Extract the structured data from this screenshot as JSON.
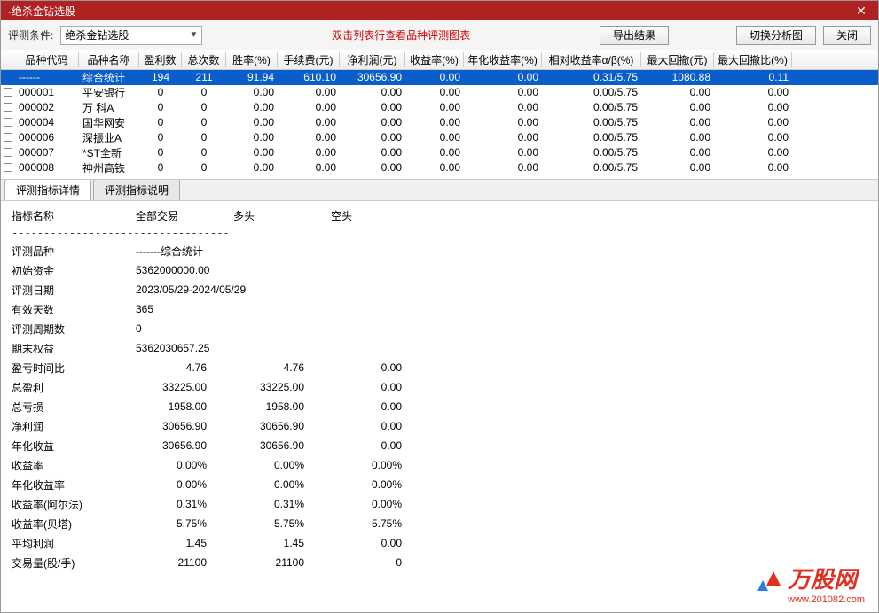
{
  "window": {
    "title": "-绝杀金钻选股"
  },
  "toolbar": {
    "condition_label": "评测条件:",
    "dropdown_value": "绝杀金钻选股",
    "hint": "双击列表行查看品种评测图表",
    "export_label": "导出结果",
    "switch_label": "切换分析图",
    "close_label": "关闭"
  },
  "table": {
    "headers": {
      "code": "品种代码",
      "name": "品种名称",
      "win": "盈利数",
      "total": "总次数",
      "rate": "胜率(%)",
      "fee": "手续费(元)",
      "profit": "净利润(元)",
      "yield": "收益率(%)",
      "ayield": "年化收益率(%)",
      "ab": "相对收益率α/β(%)",
      "maxdd": "最大回撤(元)",
      "maxddr": "最大回撤比(%)"
    },
    "rows": [
      {
        "code": "------",
        "name": "综合统计",
        "win": "194",
        "total": "211",
        "rate": "91.94",
        "fee": "610.10",
        "profit": "30656.90",
        "yield": "0.00",
        "ayield": "0.00",
        "ab": "0.31/5.75",
        "maxdd": "1080.88",
        "maxddr": "0.11",
        "selected": true
      },
      {
        "code": "000001",
        "name": "平安银行",
        "win": "0",
        "total": "0",
        "rate": "0.00",
        "fee": "0.00",
        "profit": "0.00",
        "yield": "0.00",
        "ayield": "0.00",
        "ab": "0.00/5.75",
        "maxdd": "0.00",
        "maxddr": "0.00"
      },
      {
        "code": "000002",
        "name": "万 科A",
        "win": "0",
        "total": "0",
        "rate": "0.00",
        "fee": "0.00",
        "profit": "0.00",
        "yield": "0.00",
        "ayield": "0.00",
        "ab": "0.00/5.75",
        "maxdd": "0.00",
        "maxddr": "0.00"
      },
      {
        "code": "000004",
        "name": "国华网安",
        "win": "0",
        "total": "0",
        "rate": "0.00",
        "fee": "0.00",
        "profit": "0.00",
        "yield": "0.00",
        "ayield": "0.00",
        "ab": "0.00/5.75",
        "maxdd": "0.00",
        "maxddr": "0.00"
      },
      {
        "code": "000006",
        "name": "深振业A",
        "win": "0",
        "total": "0",
        "rate": "0.00",
        "fee": "0.00",
        "profit": "0.00",
        "yield": "0.00",
        "ayield": "0.00",
        "ab": "0.00/5.75",
        "maxdd": "0.00",
        "maxddr": "0.00"
      },
      {
        "code": "000007",
        "name": "*ST全新",
        "win": "0",
        "total": "0",
        "rate": "0.00",
        "fee": "0.00",
        "profit": "0.00",
        "yield": "0.00",
        "ayield": "0.00",
        "ab": "0.00/5.75",
        "maxdd": "0.00",
        "maxddr": "0.00"
      },
      {
        "code": "000008",
        "name": "神州高铁",
        "win": "0",
        "total": "0",
        "rate": "0.00",
        "fee": "0.00",
        "profit": "0.00",
        "yield": "0.00",
        "ayield": "0.00",
        "ab": "0.00/5.75",
        "maxdd": "0.00",
        "maxddr": "0.00"
      }
    ]
  },
  "tabs": {
    "tab1": "评测指标详情",
    "tab2": "评测指标说明"
  },
  "details": {
    "header_label": "指标名称",
    "col_all": "全部交易",
    "col_long": "多头",
    "col_short": "空头",
    "separator": "----------------------------------",
    "rows": [
      {
        "label": "评测品种",
        "v1": "-------综合统计"
      },
      {
        "label": "初始资金",
        "v1": "5362000000.00"
      },
      {
        "label": "评测日期",
        "v1": "2023/05/29-2024/05/29"
      },
      {
        "label": "有效天数",
        "v1": "365"
      },
      {
        "label": "评测周期数",
        "v1": "0"
      },
      {
        "label": "期末权益",
        "v1": "5362030657.25"
      },
      {
        "label": "盈亏时间比",
        "v1": "4.76",
        "v2": "4.76",
        "v3": "0.00"
      },
      {
        "label": "总盈利",
        "v1": "33225.00",
        "v2": "33225.00",
        "v3": "0.00"
      },
      {
        "label": "总亏损",
        "v1": "1958.00",
        "v2": "1958.00",
        "v3": "0.00"
      },
      {
        "label": "净利润",
        "v1": "30656.90",
        "v2": "30656.90",
        "v3": "0.00"
      },
      {
        "label": "年化收益",
        "v1": "30656.90",
        "v2": "30656.90",
        "v3": "0.00"
      },
      {
        "label": "收益率",
        "v1": "0.00%",
        "v2": "0.00%",
        "v3": "0.00%"
      },
      {
        "label": "年化收益率",
        "v1": "0.00%",
        "v2": "0.00%",
        "v3": "0.00%"
      },
      {
        "label": "收益率(阿尔法)",
        "v1": "0.31%",
        "v2": "0.31%",
        "v3": "0.00%"
      },
      {
        "label": "收益率(贝塔)",
        "v1": "5.75%",
        "v2": "5.75%",
        "v3": "5.75%"
      },
      {
        "label": "平均利润",
        "v1": "1.45",
        "v2": "1.45",
        "v3": "0.00"
      },
      {
        "label": "交易量(股/手)",
        "v1": "21100",
        "v2": "21100",
        "v3": "0"
      }
    ]
  },
  "logo": {
    "main": "万股网",
    "sub": "www.201082.com"
  }
}
